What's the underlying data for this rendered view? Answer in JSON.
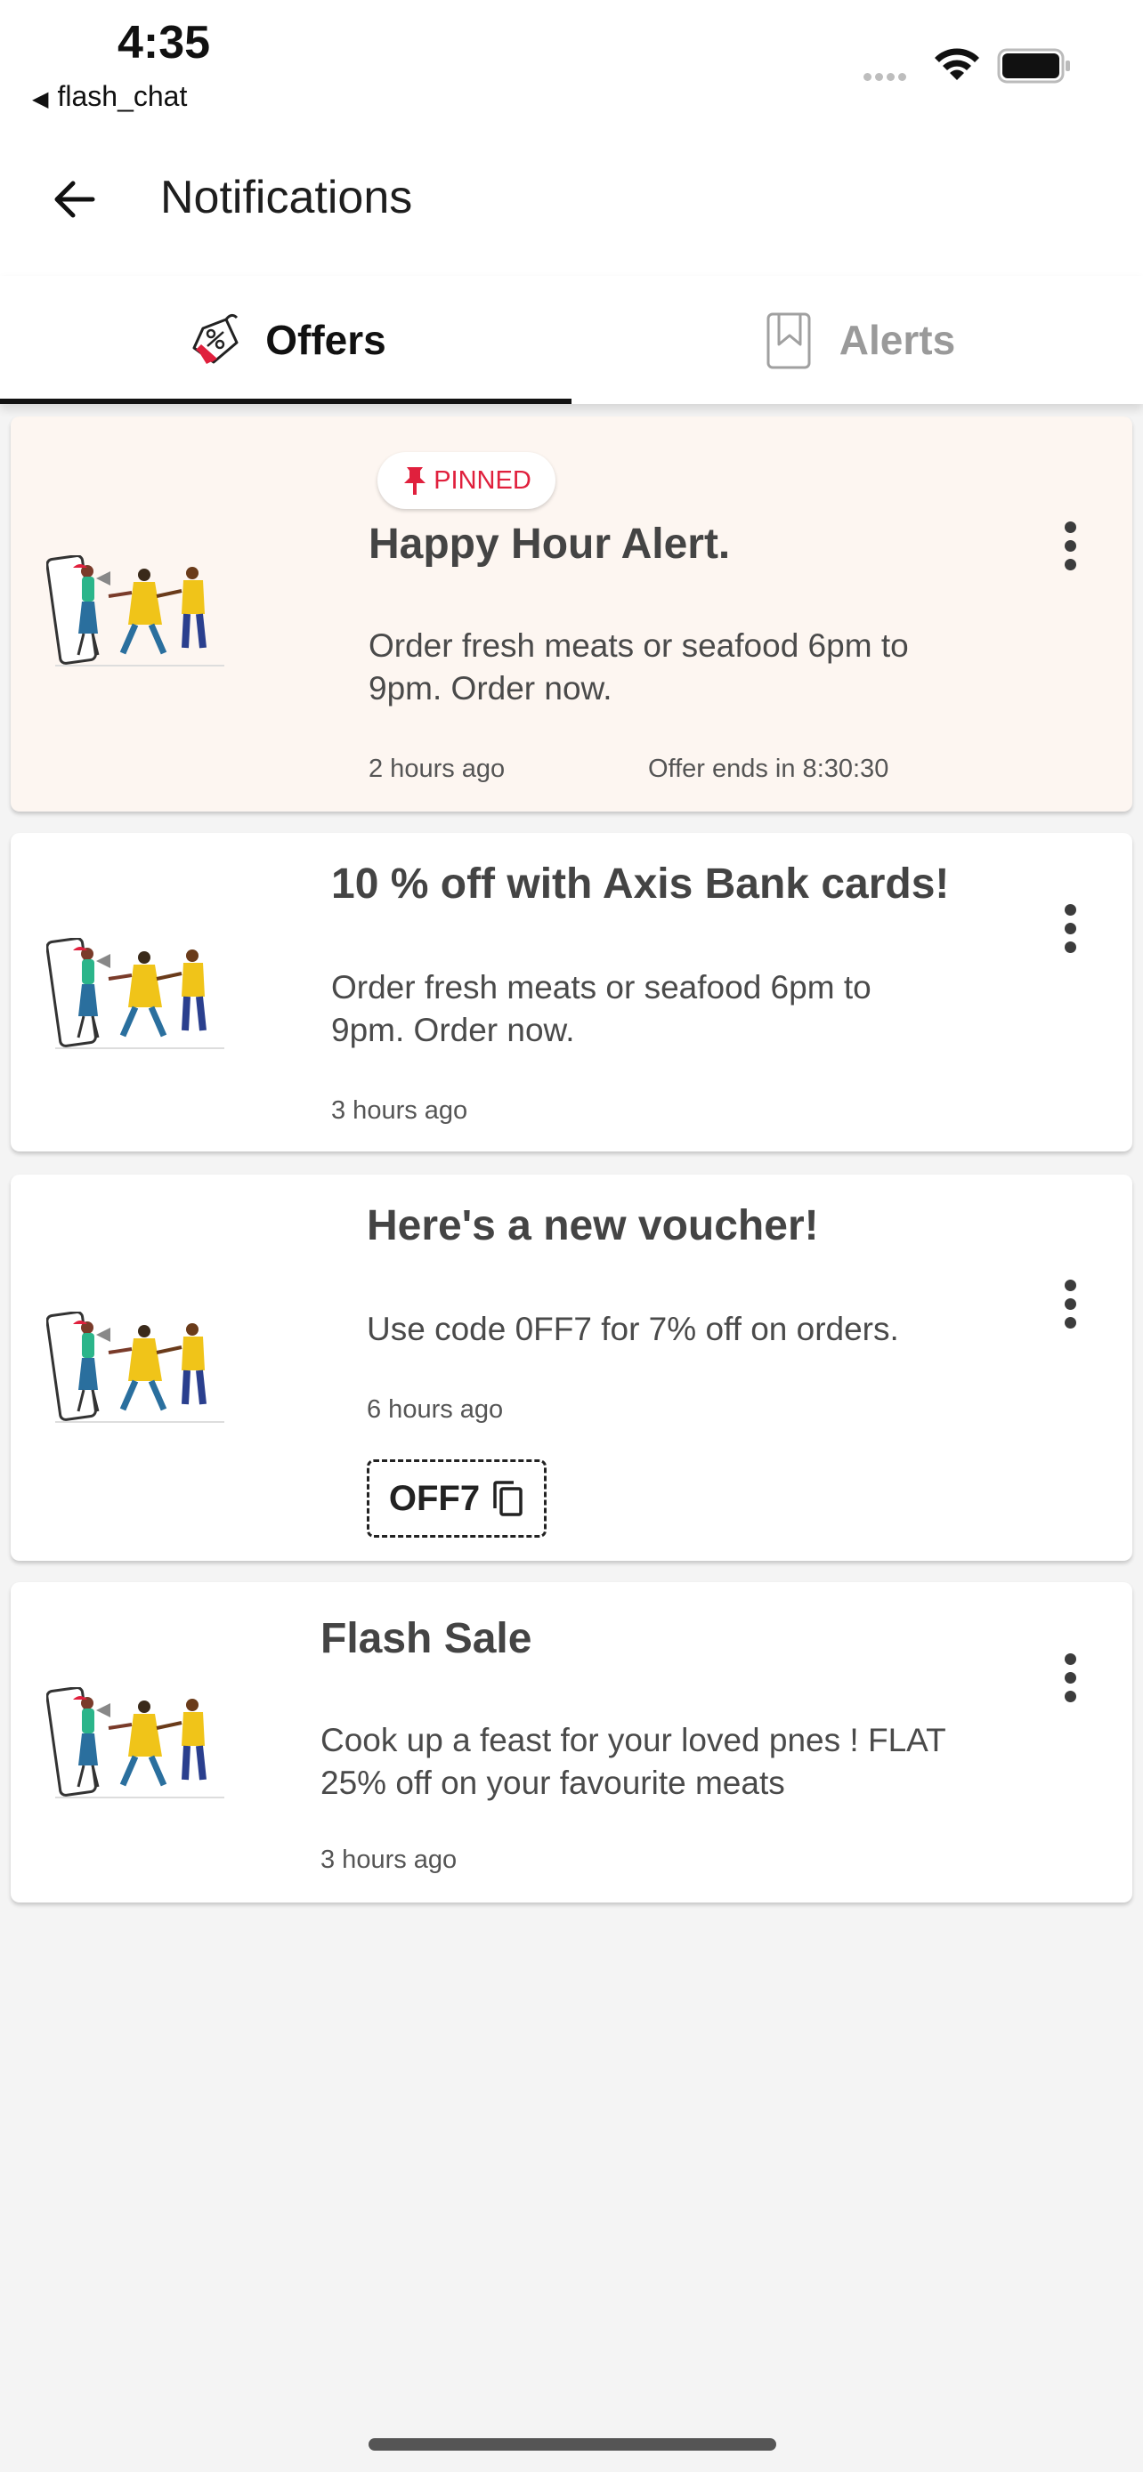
{
  "status_bar": {
    "time": "4:35",
    "back_app": "flash_chat"
  },
  "header": {
    "title": "Notifications"
  },
  "tabs": [
    {
      "label": "Offers",
      "active": true,
      "icon": "discount-bag-icon"
    },
    {
      "label": "Alerts",
      "active": false,
      "icon": "phone-alert-icon"
    }
  ],
  "notifications": [
    {
      "pinned": true,
      "badge": "PINNED",
      "title": "Happy Hour Alert.",
      "body": "Order fresh meats or seafood 6pm to 9pm. Order now.",
      "time": "2 hours ago",
      "ends": "Offer ends in 8:30:30"
    },
    {
      "title": "10 % off with Axis Bank cards!",
      "body": "Order fresh meats or seafood 6pm to 9pm. Order now.",
      "time": "3 hours ago"
    },
    {
      "title": "Here's a new voucher!",
      "body": "Use code 0FF7 for 7% off on orders.",
      "time": "6 hours ago",
      "coupon": "OFF7"
    },
    {
      "title": "Flash Sale",
      "body": "Cook up a feast for your loved pnes ! FLAT 25% off on your favourite meats",
      "time": "3 hours ago"
    }
  ],
  "colors": {
    "accent": "#e0203d",
    "pinned_bg": "#fdf6f1",
    "tab_active": "#111111",
    "tab_inactive": "#9a9a9a"
  }
}
